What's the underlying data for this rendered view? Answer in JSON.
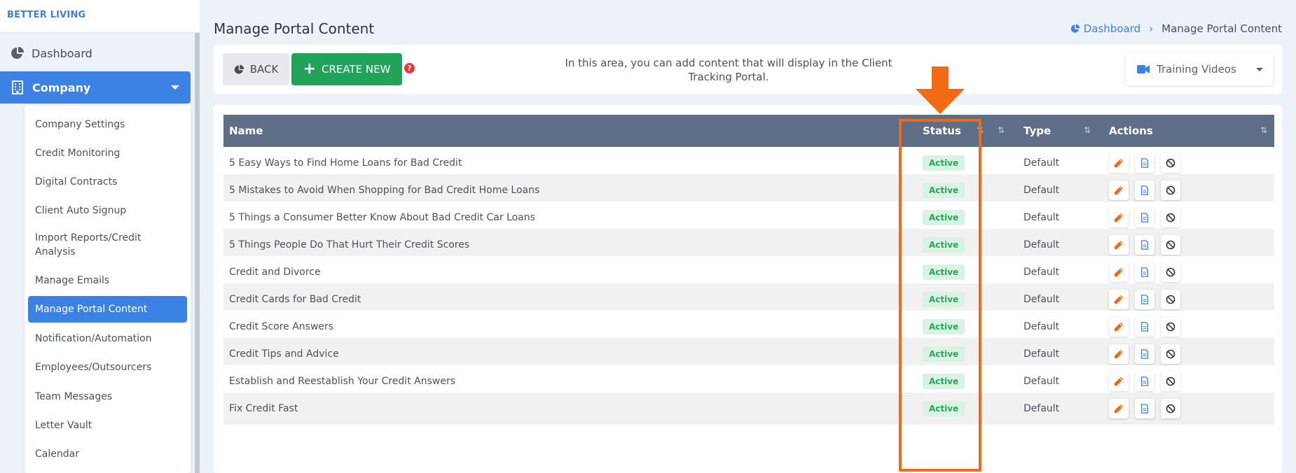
{
  "brand": "BETTER LIVING",
  "sidebar": {
    "dashboard_label": "Dashboard",
    "company_label": "Company",
    "submenu": [
      "Company Settings",
      "Credit Monitoring",
      "Digital Contracts",
      "Client Auto Signup",
      "Import Reports/Credit Analysis",
      "Manage Emails",
      "Manage Portal Content",
      "Notification/Automation",
      "Employees/Outsourcers",
      "Team Messages",
      "Letter Vault",
      "Calendar"
    ],
    "active_item": "Manage Portal Content"
  },
  "header": {
    "title": "Manage Portal Content",
    "breadcrumb": {
      "home": "Dashboard",
      "current": "Manage Portal Content"
    }
  },
  "toolbar": {
    "back_label": "BACK",
    "create_label": "CREATE NEW",
    "help_label": "?",
    "info_text": "In this area, you can add content that will display in the Client Tracking Portal.",
    "select_value": "Training Videos"
  },
  "table": {
    "columns": [
      "Name",
      "Status",
      "Type",
      "Actions"
    ],
    "sort_icon": "⇅",
    "rows": [
      {
        "name": "5 Easy Ways to Find Home Loans for Bad Credit",
        "status": "Active",
        "type": "Default"
      },
      {
        "name": "5 Mistakes to Avoid When Shopping for Bad Credit Home Loans",
        "status": "Active",
        "type": "Default"
      },
      {
        "name": "5 Things a Consumer Better Know About Bad Credit Car Loans",
        "status": "Active",
        "type": "Default"
      },
      {
        "name": "5 Things People Do That Hurt Their Credit Scores",
        "status": "Active",
        "type": "Default"
      },
      {
        "name": "Credit and Divorce",
        "status": "Active",
        "type": "Default"
      },
      {
        "name": "Credit Cards for Bad Credit",
        "status": "Active",
        "type": "Default"
      },
      {
        "name": "Credit Score Answers",
        "status": "Active",
        "type": "Default"
      },
      {
        "name": "Credit Tips and Advice",
        "status": "Active",
        "type": "Default"
      },
      {
        "name": "Establish and Reestablish Your Credit Answers",
        "status": "Active",
        "type": "Default"
      },
      {
        "name": "Fix Credit Fast",
        "status": "Active",
        "type": "Default"
      }
    ]
  },
  "icons": {
    "dashboard": "pie-chart-icon",
    "company": "building-icon",
    "edit": "pencil-icon",
    "view": "document-icon",
    "disable": "ban-icon",
    "video": "video-camera-icon"
  },
  "colors": {
    "primary": "#3b82e4",
    "create": "#22a35b",
    "table_header": "#5c6f86",
    "status_active_bg": "#d9f2e3",
    "status_active_text": "#27a85f",
    "highlight": "#f26b14"
  }
}
